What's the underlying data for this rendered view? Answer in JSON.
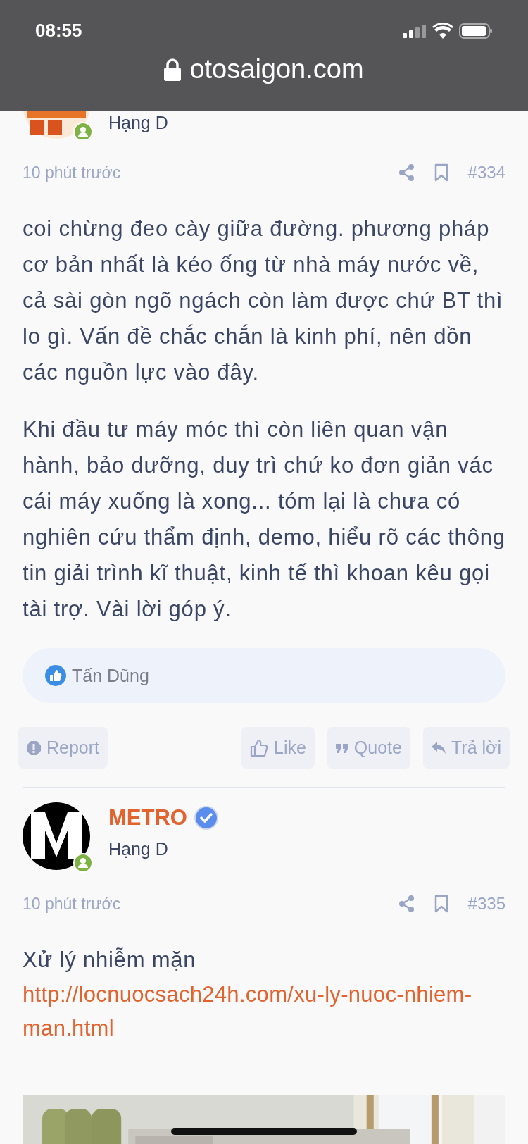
{
  "status_bar": {
    "time": "08:55"
  },
  "browser": {
    "url": "otosaigon.com",
    "secure": true
  },
  "posts": [
    {
      "cut_off": true,
      "rank": "Hạng D",
      "online": true,
      "time": "10 phút trước",
      "number": "#334",
      "body": [
        {
          "kind": "text",
          "text": "coi chừng đeo cày giữa đường. phương pháp cơ bản nhất là kéo ống từ nhà máy nước về, cả sài gòn ngõ ngách còn làm được chứ BT thì lo gì. Vấn đề chắc chắn là kinh phí, nên dồn các nguồn lực vào đây."
        },
        {
          "kind": "text",
          "text": "Khi đầu tư máy móc thì còn liên quan vận hành, bảo dưỡng, duy trì chứ ko đơn giản vác cái máy xuống là xong... tóm lại là chưa có nghiên cứu thẩm định, demo, hiểu rõ các thông tin giải trình kĩ thuật, kinh tế thì khoan kêu gọi tài trợ. Vài lời góp ý."
        }
      ],
      "reactions": [
        "Tấn Dũng"
      ],
      "actions": [
        {
          "kind": "report",
          "label": "Report"
        },
        {
          "kind": "like",
          "label": "Like"
        },
        {
          "kind": "quote",
          "label": "Quote"
        },
        {
          "kind": "reply",
          "label": "Trả lời"
        }
      ]
    },
    {
      "cut_off": false,
      "author": "METRO",
      "verified": true,
      "rank": "Hạng D",
      "online": true,
      "time": "10 phút trước",
      "number": "#335",
      "body": [
        {
          "kind": "text",
          "text": "Xử lý nhiễm mặn"
        },
        {
          "kind": "link",
          "text": "http://locnuocsach24h.com/xu-ly-nuoc-nhiem-man.html"
        },
        {
          "kind": "picture"
        }
      ]
    }
  ]
}
